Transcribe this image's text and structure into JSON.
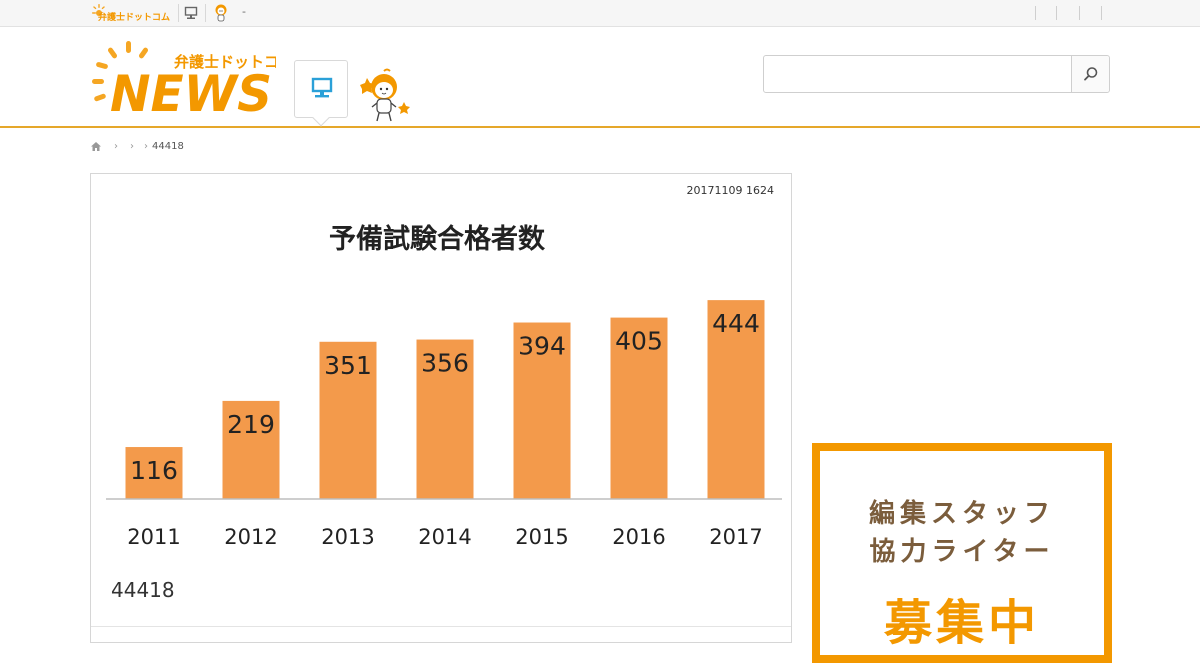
{
  "header": {
    "logo_top": "弁護士ドットコム",
    "logo_main": "NEWS",
    "top_dash": "-",
    "search_placeholder": ""
  },
  "breadcrumb": {
    "current": "44418"
  },
  "article": {
    "date": "20171109 1624",
    "caption": "44418"
  },
  "chart_data": {
    "type": "bar",
    "title": "予備試験合格者数",
    "categories": [
      "2011",
      "2012",
      "2013",
      "2014",
      "2015",
      "2016",
      "2017"
    ],
    "values": [
      116,
      219,
      351,
      356,
      394,
      405,
      444
    ],
    "ylim": [
      0,
      480
    ],
    "grid": false,
    "color": "#f39a4b"
  },
  "recruit": {
    "line1": "編集スタッフ",
    "line2": "協力ライター",
    "line3": "募集中"
  },
  "colors": {
    "accent": "#f39800",
    "header_rule": "#e5a72a",
    "brown": "#7b5d3c",
    "bar": "#f39a4b"
  }
}
